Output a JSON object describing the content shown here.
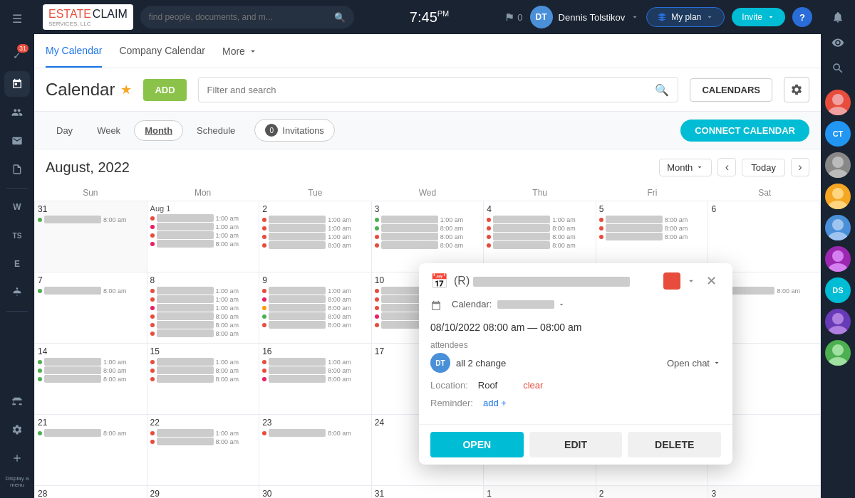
{
  "app": {
    "name": "Estate Claim Services",
    "logo_line1": "ESTATE",
    "logo_line2": "CLAIM",
    "logo_line3": "SERVICES, LLC"
  },
  "navbar": {
    "search_placeholder": "find people, documents, and m...",
    "time": "7:45",
    "time_suffix": "PM",
    "flag_count": "0",
    "user_name": "Dennis Tolstikov",
    "my_plan_label": "My plan",
    "invite_label": "Invite",
    "help_label": "?"
  },
  "calendar_tabs": {
    "my_calendar": "My Calendar",
    "company_calendar": "Company Calendar",
    "more": "More"
  },
  "calendar_header": {
    "title": "Calendar",
    "add_label": "ADD",
    "filter_placeholder": "Filter and search",
    "calendars_label": "CALENDARS"
  },
  "view_controls": {
    "day": "Day",
    "week": "Week",
    "month": "Month",
    "schedule": "Schedule",
    "invitations_count": "0",
    "invitations_label": "Invitations",
    "connect_calendar_label": "CONNECT CALENDAR"
  },
  "calendar": {
    "month_title": "August, 2022",
    "month_view_label": "Month",
    "today_label": "Today",
    "day_headers": [
      "Sun",
      "Mon",
      "Tue",
      "Wed",
      "Thu",
      "Fri",
      "Sat"
    ]
  },
  "popup": {
    "title": "R) ████████████████████████████████████████",
    "calendar_label": "Calendar:",
    "calendar_value": "████████████",
    "datetime": "08/10/2022   08:00 am  —  08:00 am",
    "attendees_label": "attendees",
    "attendee_name": "all 2 change",
    "open_chat_label": "Open chat",
    "location_label": "Location:",
    "location_value": "Roof",
    "clear_label": "clear",
    "reminder_label": "Reminder:",
    "add_label": "add +",
    "open_btn": "OPEN",
    "edit_btn": "EDIT",
    "delete_btn": "DELETE"
  },
  "sidebar_icons": [
    {
      "name": "menu",
      "icon": "☰",
      "active": false
    },
    {
      "name": "tasks",
      "icon": "✓",
      "badge": "31",
      "active": false
    },
    {
      "name": "calendar",
      "icon": "📅",
      "active": true
    },
    {
      "name": "people",
      "icon": "👥",
      "active": false
    },
    {
      "name": "mail",
      "icon": "✉",
      "active": false
    },
    {
      "name": "docs",
      "icon": "📄",
      "active": false
    },
    {
      "name": "w",
      "label": "W",
      "active": false
    },
    {
      "name": "ts",
      "label": "TS",
      "active": false
    },
    {
      "name": "e",
      "label": "E",
      "active": false
    },
    {
      "name": "robot",
      "icon": "🤖",
      "active": false
    }
  ],
  "right_sidebar": [
    {
      "name": "bell",
      "icon": "🔔"
    },
    {
      "name": "eye",
      "icon": "👁"
    },
    {
      "name": "search",
      "icon": "🔍"
    },
    {
      "name": "avatar1",
      "color": "#e74c3c",
      "label": ""
    },
    {
      "name": "avatar2",
      "color": "#2196f3",
      "label": "CT"
    },
    {
      "name": "avatar3",
      "color": "#ff9800",
      "label": ""
    },
    {
      "name": "avatar4",
      "color": "#4caf50",
      "label": ""
    },
    {
      "name": "avatar5",
      "color": "#9c27b0",
      "label": ""
    },
    {
      "name": "avatar6",
      "color": "#e91e63",
      "label": ""
    },
    {
      "name": "avatar7",
      "color": "#00bcd4",
      "label": "DS"
    },
    {
      "name": "avatar8",
      "color": "#673ab7",
      "label": ""
    },
    {
      "name": "avatar9",
      "color": "#4caf50",
      "label": ""
    }
  ]
}
